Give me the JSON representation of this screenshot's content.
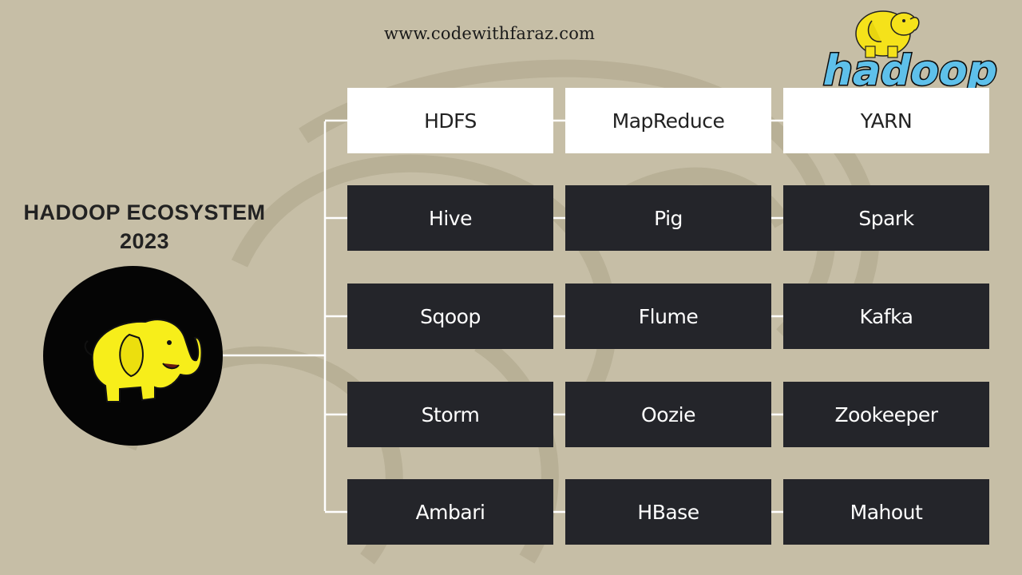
{
  "header": {
    "site_url": "www.codewithfaraz.com",
    "logo_text": "hadoop"
  },
  "title": {
    "line1": "HADOOP ECOSYSTEM",
    "line2": "2023"
  },
  "colors": {
    "background": "#c6bea6",
    "core_box": "#ffffff",
    "tool_box": "#24252a",
    "elephant_yellow": "#f5ec1c",
    "logo_blue": "#5ec0ea",
    "connector": "#ffffff"
  },
  "grid": {
    "rows": [
      [
        "HDFS",
        "MapReduce",
        "YARN"
      ],
      [
        "Hive",
        "Pig",
        "Spark"
      ],
      [
        "Sqoop",
        "Flume",
        "Kafka"
      ],
      [
        "Storm",
        "Oozie",
        "Zookeeper"
      ],
      [
        "Ambari",
        "HBase",
        "Mahout"
      ]
    ],
    "core_row_index": 0
  },
  "icons": {
    "badge": "hadoop-elephant-icon",
    "logo": "hadoop-logo-icon"
  }
}
